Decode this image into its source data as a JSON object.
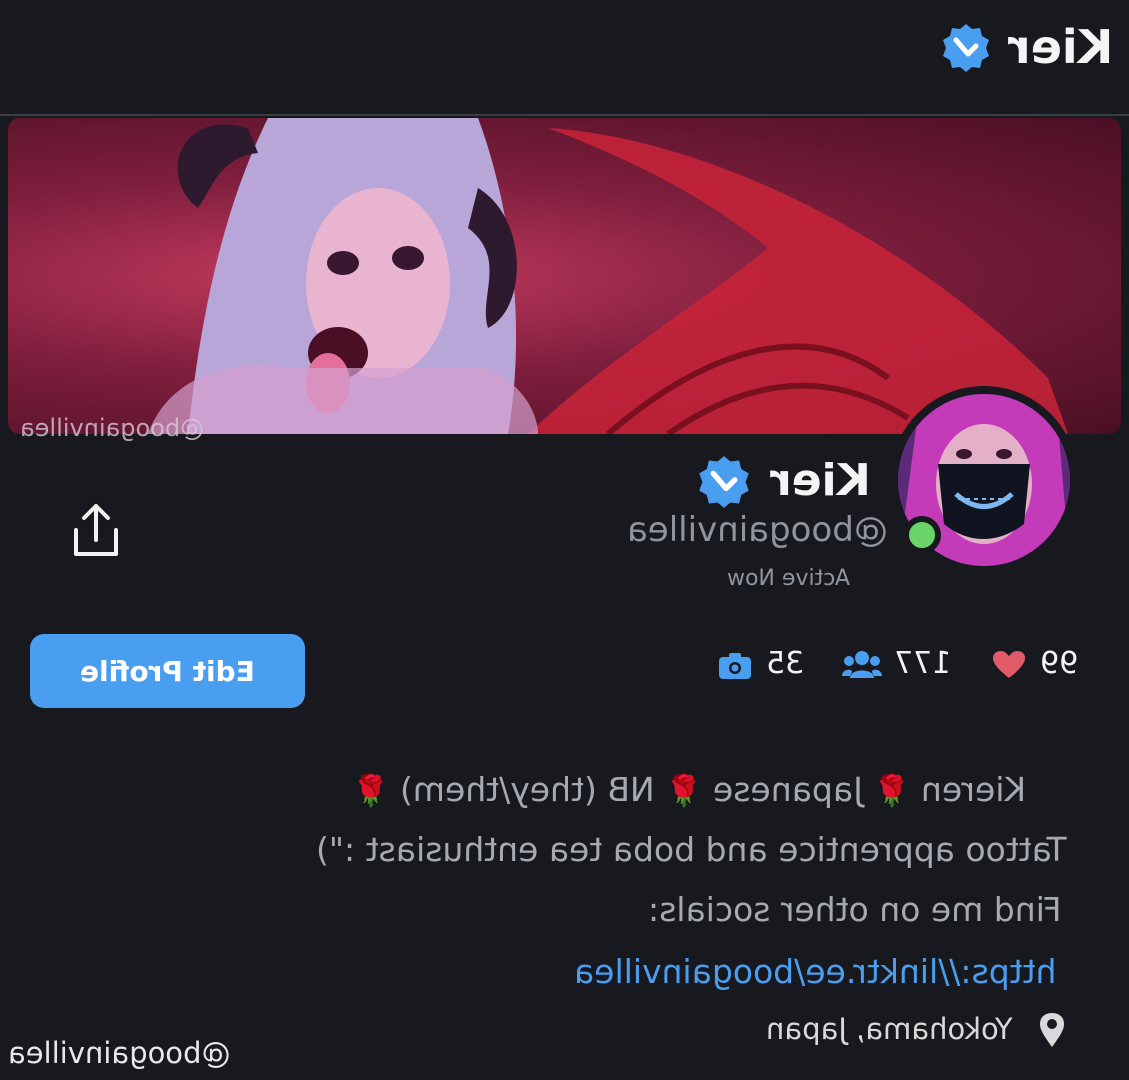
{
  "header": {
    "title": "Kier",
    "verified_icon": "verified-badge-icon"
  },
  "banner": {
    "watermark": "@boogainvillea"
  },
  "profile": {
    "name": "Kier",
    "handle": "@boogainvillea",
    "status": "Active Now",
    "online": true,
    "share_icon": "share-icon"
  },
  "actions": {
    "edit_label": "Edit Profile"
  },
  "stats": {
    "likes": "99",
    "followers": "177",
    "media": "35"
  },
  "bio": {
    "line1_parts": [
      "Kieren",
      "Japanese",
      "NB (they/them)"
    ],
    "rose": "🌹",
    "line2": "Tattoo apprentice and boba tea enthusiast :\")",
    "line3": "Find me on other socials:",
    "link": "https://linktr.ee/boogainvillea",
    "location": "Yokohama, Japan"
  },
  "footer": {
    "watermark": "@boogainvillea"
  },
  "colors": {
    "accent": "#4a9eef",
    "background": "#17191e",
    "online": "#6ad36a",
    "heart": "#e05a6a"
  }
}
